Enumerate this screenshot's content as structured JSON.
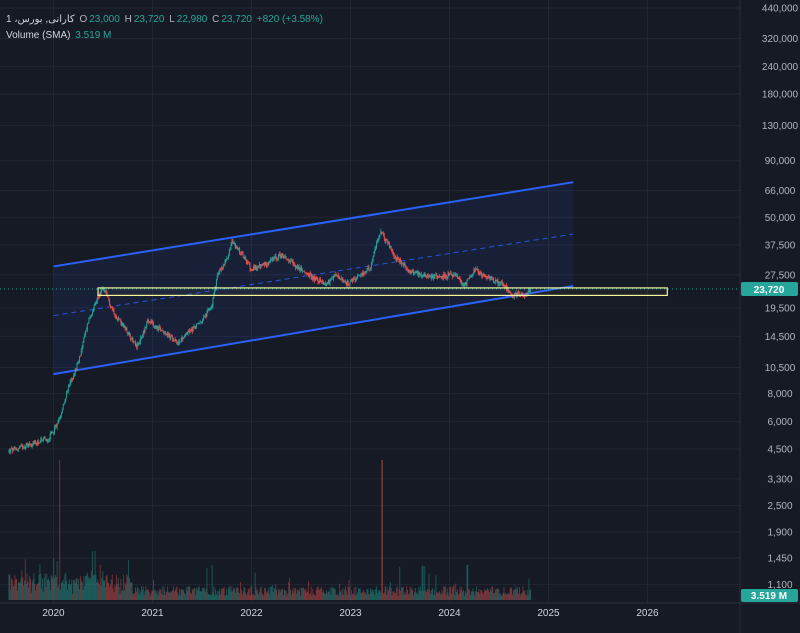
{
  "header": {
    "symbol": "1 ،کارانی, بورس",
    "open_label": "O",
    "open": "23,000",
    "high_label": "H",
    "high": "23,720",
    "low_label": "L",
    "low": "22,980",
    "close_label": "C",
    "close": "23,720",
    "change": "+820 (+3.58%)",
    "volume_label": "Volume (SMA)",
    "volume_value": "3.519 M"
  },
  "colors": {
    "background": "#161a25",
    "up": "#26a69a",
    "down": "#ef5350",
    "channel": "#2962ff",
    "support_box": "#f5f59a",
    "price_tag": "#26a69a"
  },
  "chart_data": {
    "type": "candlestick",
    "price_scale": "log",
    "ylim": [
      4000,
      440000
    ],
    "x_ticks": [
      "2020",
      "2021",
      "2022",
      "2023",
      "2024",
      "2025",
      "2026"
    ],
    "y_ticks": [
      {
        "value": 440000,
        "label": "440,000"
      },
      {
        "value": 320000,
        "label": "320,000"
      },
      {
        "value": 240000,
        "label": "240,000"
      },
      {
        "value": 180000,
        "label": "180,000"
      },
      {
        "value": 130000,
        "label": "130,000"
      },
      {
        "value": 90000,
        "label": "90,000"
      },
      {
        "value": 66000,
        "label": "66,000"
      },
      {
        "value": 50000,
        "label": "50,000"
      },
      {
        "value": 37500,
        "label": "37,500"
      },
      {
        "value": 27500,
        "label": "27,500"
      },
      {
        "value": 19500,
        "label": "19,500"
      },
      {
        "value": 14500,
        "label": "14,500"
      },
      {
        "value": 10500,
        "label": "10,500"
      },
      {
        "value": 8000,
        "label": "8,000"
      },
      {
        "value": 6000,
        "label": "6,000"
      },
      {
        "value": 4500,
        "label": "4,500"
      },
      {
        "value": 3300,
        "label": "3,300"
      },
      {
        "value": 2500,
        "label": "2,500"
      },
      {
        "value": 1900,
        "label": "1,900"
      },
      {
        "value": 1450,
        "label": "1,450"
      },
      {
        "value": 1100,
        "label": "1,100"
      }
    ],
    "last_price": {
      "value": 23720,
      "label": "23,720"
    },
    "last_volume": {
      "label": "3.519 M"
    },
    "price_path": [
      [
        2019.55,
        4400
      ],
      [
        2019.75,
        4700
      ],
      [
        2019.95,
        5000
      ],
      [
        2020.05,
        6000
      ],
      [
        2020.15,
        8500
      ],
      [
        2020.25,
        11000
      ],
      [
        2020.35,
        17000
      ],
      [
        2020.45,
        22000
      ],
      [
        2020.5,
        24000
      ],
      [
        2020.6,
        19000
      ],
      [
        2020.75,
        15000
      ],
      [
        2020.85,
        13000
      ],
      [
        2020.95,
        17000
      ],
      [
        2021.1,
        15500
      ],
      [
        2021.25,
        13500
      ],
      [
        2021.35,
        15000
      ],
      [
        2021.5,
        17000
      ],
      [
        2021.6,
        20000
      ],
      [
        2021.65,
        27000
      ],
      [
        2021.75,
        32000
      ],
      [
        2021.8,
        39000
      ],
      [
        2021.9,
        34000
      ],
      [
        2022.0,
        29000
      ],
      [
        2022.15,
        31000
      ],
      [
        2022.3,
        34000
      ],
      [
        2022.45,
        30000
      ],
      [
        2022.6,
        27000
      ],
      [
        2022.75,
        25000
      ],
      [
        2022.85,
        27500
      ],
      [
        2022.95,
        25000
      ],
      [
        2023.1,
        27000
      ],
      [
        2023.2,
        30000
      ],
      [
        2023.3,
        43000
      ],
      [
        2023.38,
        38000
      ],
      [
        2023.45,
        33000
      ],
      [
        2023.6,
        28500
      ],
      [
        2023.75,
        27500
      ],
      [
        2023.9,
        27000
      ],
      [
        2024.05,
        27500
      ],
      [
        2024.15,
        24500
      ],
      [
        2024.25,
        29000
      ],
      [
        2024.4,
        26500
      ],
      [
        2024.55,
        25000
      ],
      [
        2024.62,
        22000
      ],
      [
        2024.7,
        22500
      ],
      [
        2024.75,
        22200
      ],
      [
        2024.82,
        23720
      ]
    ],
    "volume_spikes": [
      {
        "x": 2020.06,
        "value": 2.0
      },
      {
        "x": 2020.42,
        "value": 0.7
      },
      {
        "x": 2021.6,
        "value": 0.5
      },
      {
        "x": 2023.32,
        "value": 2.0
      },
      {
        "x": 2024.18,
        "value": 0.5
      }
    ],
    "channel": {
      "upper": [
        [
          2020.0,
          30000
        ],
        [
          2025.25,
          72000
        ]
      ],
      "middle": [
        [
          2020.0,
          18000
        ],
        [
          2025.25,
          42000
        ]
      ],
      "lower": [
        [
          2020.0,
          9800
        ],
        [
          2025.25,
          24500
        ]
      ]
    },
    "support_zone": {
      "x0": 2020.45,
      "x1": 2026.2,
      "y0": 22200,
      "y1": 24000
    }
  }
}
